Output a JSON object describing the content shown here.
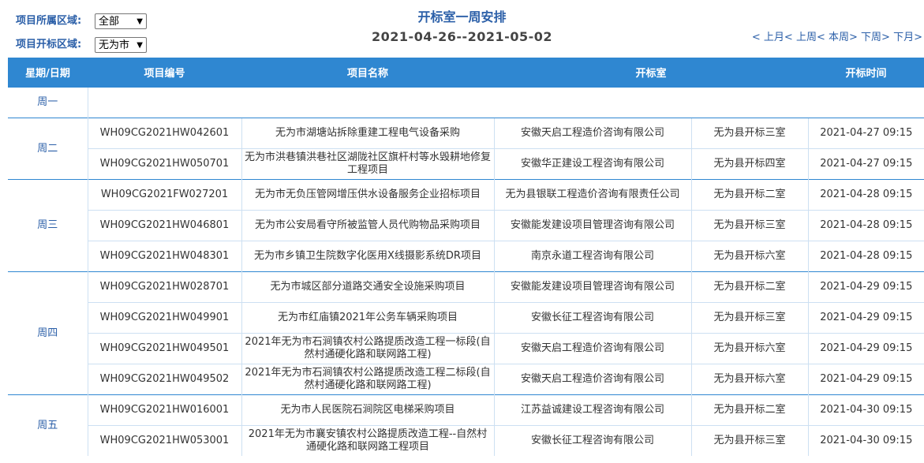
{
  "filters": {
    "area_label": "项目所属区域:",
    "area_value": "全部",
    "open_label": "项目开标区域:",
    "open_value": "无为市"
  },
  "header": {
    "title": "开标室一周安排",
    "date_range": "2021-04-26--2021-05-02"
  },
  "nav": {
    "prev_month": "上月",
    "prev_week": "上周",
    "this_week": "本周",
    "next_week": "下周",
    "next_month": "下月"
  },
  "table": {
    "columns": [
      "星期/日期",
      "项目编号",
      "项目名称",
      "开标室",
      "开标时间"
    ],
    "groups": [
      {
        "day": "周一",
        "rows": []
      },
      {
        "day": "周二",
        "rows": [
          {
            "code": "WH09CG2021HW042601",
            "name": "无为市湖塘站拆除重建工程电气设备采购",
            "agency": "安徽天启工程造价咨询有限公司",
            "room": "无为县开标三室",
            "time": "2021-04-27 09:15"
          },
          {
            "code": "WH09CG2021HW050701",
            "name": "无为市洪巷镇洪巷社区湖陇社区旗杆村等水毁耕地修复工程项目",
            "agency": "安徽华正建设工程咨询有限公司",
            "room": "无为县开标四室",
            "time": "2021-04-27 09:15"
          }
        ]
      },
      {
        "day": "周三",
        "rows": [
          {
            "code": "WH09CG2021FW027201",
            "name": "无为市无负压管网增压供水设备服务企业招标项目",
            "agency": "无为县银联工程造价咨询有限责任公司",
            "room": "无为县开标二室",
            "time": "2021-04-28 09:15"
          },
          {
            "code": "WH09CG2021HW046801",
            "name": "无为市公安局看守所被监管人员代购物品采购项目",
            "agency": "安徽能发建设项目管理咨询有限公司",
            "room": "无为县开标三室",
            "time": "2021-04-28 09:15"
          },
          {
            "code": "WH09CG2021HW048301",
            "name": "无为市乡镇卫生院数字化医用X线摄影系统DR项目",
            "agency": "南京永道工程咨询有限公司",
            "room": "无为县开标六室",
            "time": "2021-04-28 09:15"
          }
        ]
      },
      {
        "day": "周四",
        "rows": [
          {
            "code": "WH09CG2021HW028701",
            "name": "无为市城区部分道路交通安全设施采购项目",
            "agency": "安徽能发建设项目管理咨询有限公司",
            "room": "无为县开标二室",
            "time": "2021-04-29 09:15"
          },
          {
            "code": "WH09CG2021HW049901",
            "name": "无为市红庙镇2021年公务车辆采购项目",
            "agency": "安徽长征工程咨询有限公司",
            "room": "无为县开标三室",
            "time": "2021-04-29 09:15"
          },
          {
            "code": "WH09CG2021HW049501",
            "name": "2021年无为市石涧镇农村公路提质改造工程一标段(自然村通硬化路和联网路工程)",
            "agency": "安徽天启工程造价咨询有限公司",
            "room": "无为县开标六室",
            "time": "2021-04-29 09:15"
          },
          {
            "code": "WH09CG2021HW049502",
            "name": "2021年无为市石涧镇农村公路提质改造工程二标段(自然村通硬化路和联网路工程)",
            "agency": "安徽天启工程造价咨询有限公司",
            "room": "无为县开标六室",
            "time": "2021-04-29 09:15"
          }
        ]
      },
      {
        "day": "周五",
        "rows": [
          {
            "code": "WH09CG2021HW016001",
            "name": "无为市人民医院石涧院区电梯采购项目",
            "agency": "江苏益诚建设工程咨询有限公司",
            "room": "无为县开标二室",
            "time": "2021-04-30 09:15"
          },
          {
            "code": "WH09CG2021HW053001",
            "name": "2021年无为市襄安镇农村公路提质改造工程--自然村通硬化路和联网路工程项目",
            "agency": "安徽长征工程咨询有限公司",
            "room": "无为县开标三室",
            "time": "2021-04-30 09:15"
          }
        ]
      }
    ]
  }
}
